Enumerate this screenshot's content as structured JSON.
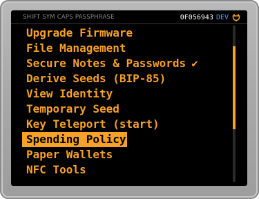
{
  "status_bar": {
    "modifiers": [
      "SHIFT",
      "SYM",
      "CAPS",
      "PASSPHRASE"
    ],
    "fingerprint": "0F056943",
    "build": "DEV",
    "power_icon": "usb-plug-icon"
  },
  "menu": {
    "items": [
      {
        "label": "Upgrade Firmware"
      },
      {
        "label": "File Management"
      },
      {
        "label": "Secure Notes & Passwords",
        "checked_mark": "✔"
      },
      {
        "label": "Derive Seeds (BIP-85)"
      },
      {
        "label": "View Identity"
      },
      {
        "label": "Temporary Seed"
      },
      {
        "label": "Key Teleport (start)"
      },
      {
        "label": "Spending Policy",
        "selected": true
      },
      {
        "label": "Paper Wallets"
      },
      {
        "label": "NFC Tools"
      }
    ]
  },
  "colors": {
    "accent": "#f7a128",
    "background": "#000000",
    "status_text": "#8a8a8a",
    "dev_tag": "#4da3ff",
    "bezel": "#a9a9a9"
  }
}
